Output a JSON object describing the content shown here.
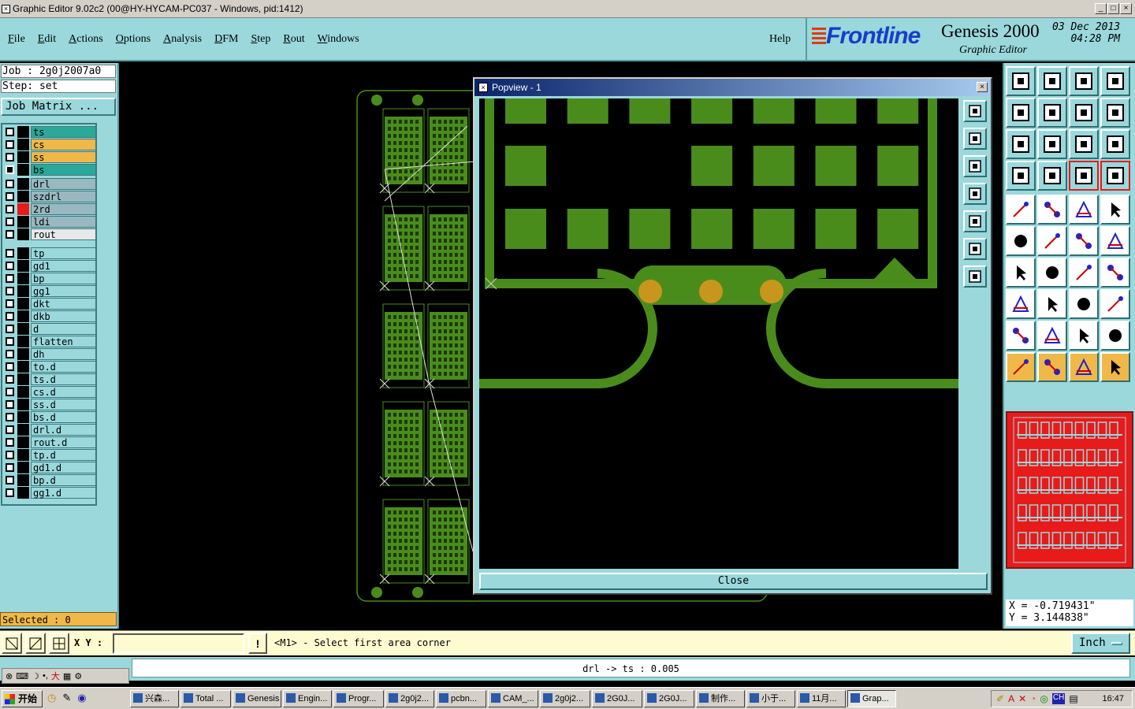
{
  "window": {
    "title": "Graphic Editor 9.02c2 (00@HY-HYCAM-PC037 - Windows, pid:1412)"
  },
  "menu": {
    "items": [
      "File",
      "Edit",
      "Actions",
      "Options",
      "Analysis",
      "DFM",
      "Step",
      "Rout",
      "Windows"
    ],
    "help": "Help"
  },
  "brand": {
    "logo": "Frontline",
    "product": "Genesis 2000",
    "subtitle": "Graphic Editor",
    "date": "03 Dec 2013",
    "time": "04:28 PM"
  },
  "job": {
    "job_line": "Job : 2g0j2007a0",
    "step_line": "Step: set",
    "matrix_button": "Job Matrix ..."
  },
  "layers": [
    {
      "name": "ts",
      "color": "#2aa89a",
      "checked": false
    },
    {
      "name": "cs",
      "color": "#f0b848",
      "checked": false
    },
    {
      "name": "ss",
      "color": "#f0b848",
      "checked": false
    },
    {
      "name": "bs",
      "color": "#2aa89a",
      "checked": true
    },
    {
      "name": "drl",
      "color": "#9ab8c0",
      "checked": false
    },
    {
      "name": "szdrl",
      "color": "#9ab8c0",
      "checked": false
    },
    {
      "name": "2rd",
      "color": "#9ab8c0",
      "checked": false,
      "swatch": "#e81a1a"
    },
    {
      "name": "ldi",
      "color": "#9ab8c0",
      "checked": false
    },
    {
      "name": "rout",
      "color": "#e8e8e8",
      "checked": false
    },
    {
      "name": "tp",
      "color": "#9ad8dc",
      "checked": false
    },
    {
      "name": "gd1",
      "color": "#9ad8dc",
      "checked": false
    },
    {
      "name": "bp",
      "color": "#9ad8dc",
      "checked": false
    },
    {
      "name": "gg1",
      "color": "#9ad8dc",
      "checked": false
    },
    {
      "name": "dkt",
      "color": "#9ad8dc",
      "checked": false
    },
    {
      "name": "dkb",
      "color": "#9ad8dc",
      "checked": false
    },
    {
      "name": "d",
      "color": "#9ad8dc",
      "checked": false
    },
    {
      "name": "flatten",
      "color": "#9ad8dc",
      "checked": false
    },
    {
      "name": "dh",
      "color": "#9ad8dc",
      "checked": false
    },
    {
      "name": "to.d",
      "color": "#9ad8dc",
      "checked": false
    },
    {
      "name": "ts.d",
      "color": "#9ad8dc",
      "checked": false
    },
    {
      "name": "cs.d",
      "color": "#9ad8dc",
      "checked": false
    },
    {
      "name": "ss.d",
      "color": "#9ad8dc",
      "checked": false
    },
    {
      "name": "bs.d",
      "color": "#9ad8dc",
      "checked": false
    },
    {
      "name": "drl.d",
      "color": "#9ad8dc",
      "checked": false
    },
    {
      "name": "rout.d",
      "color": "#9ad8dc",
      "checked": false
    },
    {
      "name": "tp.d",
      "color": "#9ad8dc",
      "checked": false
    },
    {
      "name": "gd1.d",
      "color": "#9ad8dc",
      "checked": false
    },
    {
      "name": "bp.d",
      "color": "#9ad8dc",
      "checked": false
    },
    {
      "name": "gg1.d",
      "color": "#9ad8dc",
      "checked": false
    }
  ],
  "selected": "Selected : 0",
  "popview": {
    "title": "Popview - 1",
    "close_label": "Close"
  },
  "coords": {
    "x": "X = -0.719431\"",
    "y": "Y = 3.144838\""
  },
  "command": {
    "xy_label": "X Y :",
    "xy_value": "",
    "prompt": "<M1> - Select first area corner",
    "unit": "Inch"
  },
  "status": "drl -> ts : 0.005",
  "taskbar": {
    "start": "开始",
    "tasks": [
      "兴森...",
      "Total ...",
      "Genesis",
      "Engin...",
      "Progr...",
      "2g0j2...",
      "pcbn...",
      "CAM_...",
      "2g0j2...",
      "2G0J...",
      "2G0J...",
      "制作...",
      "小于...",
      "11月...",
      "Grap..."
    ],
    "clock": "16:47"
  },
  "colors": {
    "panel": "#9ad8dc",
    "copper": "#4a8c1c",
    "pad_orange": "#c8961c",
    "thumb_red": "#e81a1a",
    "thumb_cyan": "#9ad8dc"
  }
}
